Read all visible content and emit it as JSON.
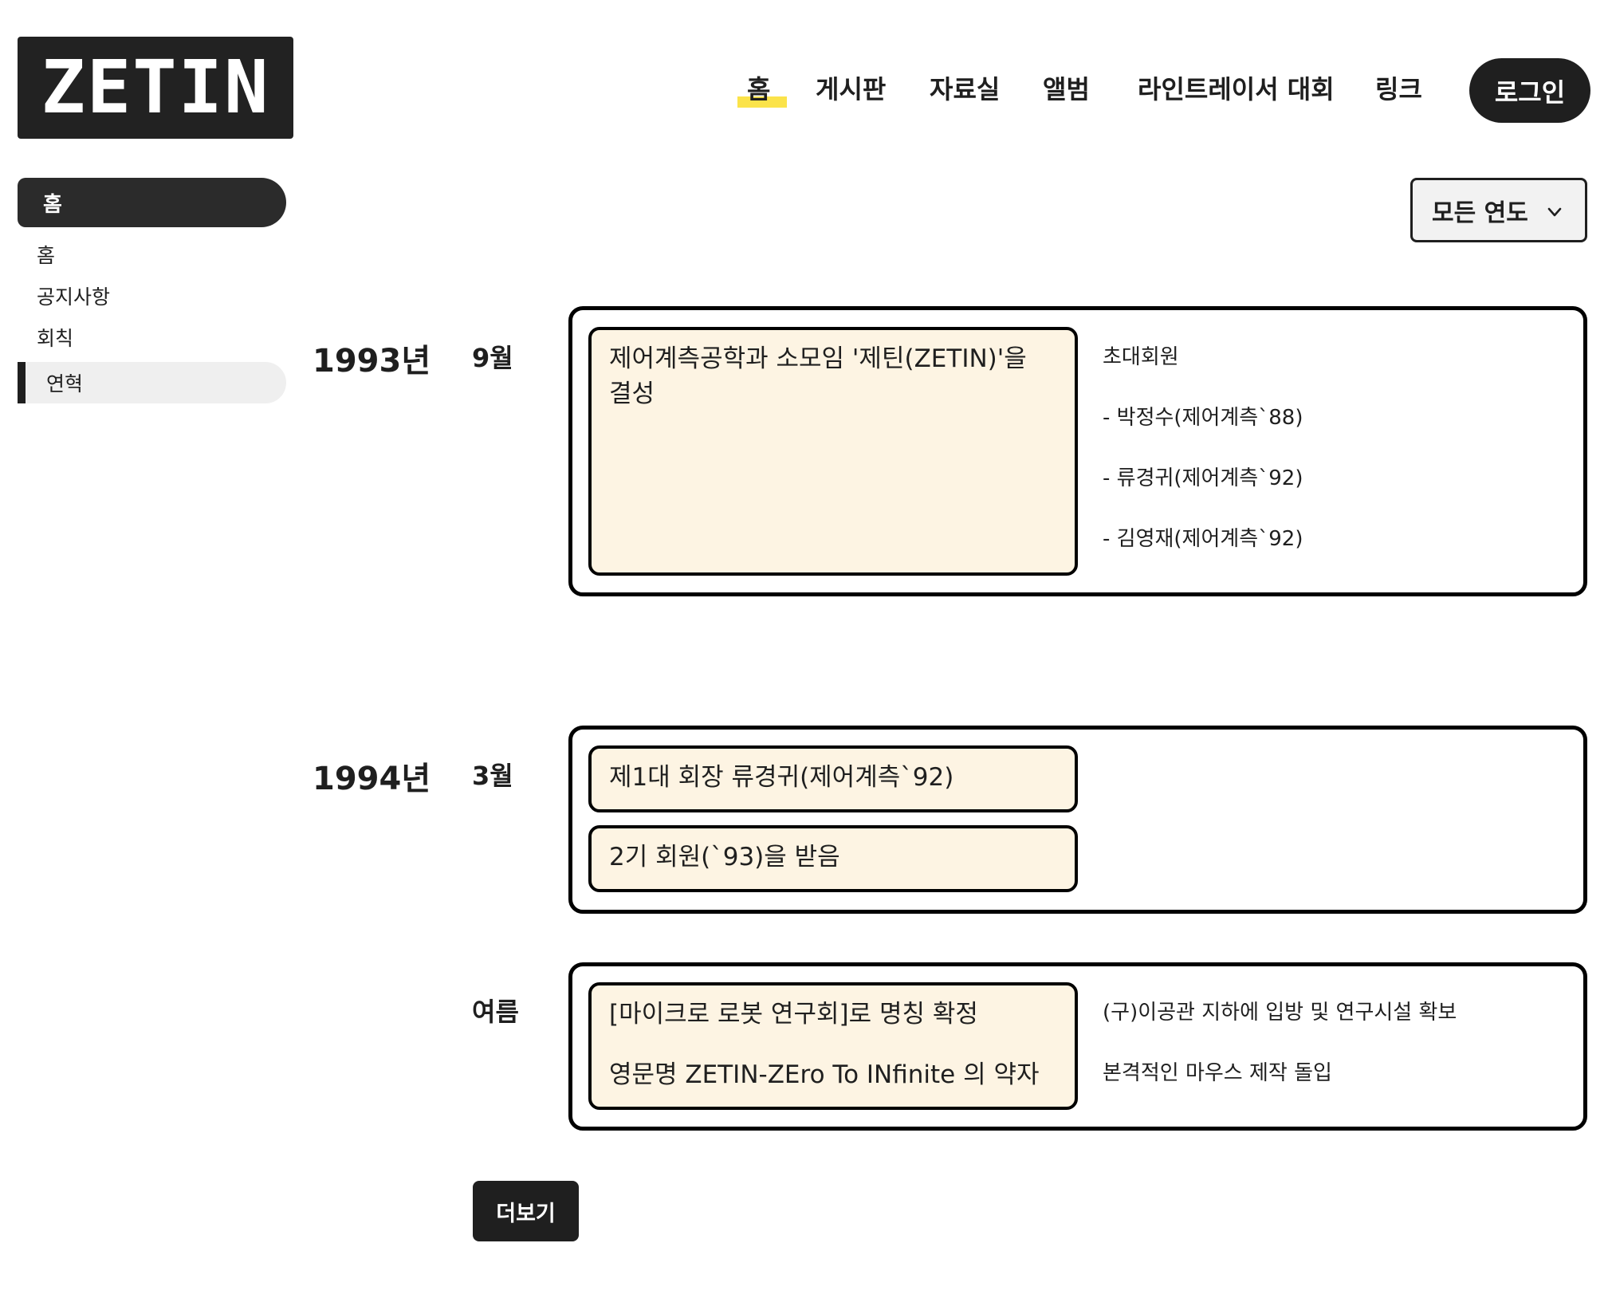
{
  "logo": "ZETIN",
  "nav": {
    "items": [
      "홈",
      "게시판",
      "자료실",
      "앨범",
      "라인트레이서 대회",
      "링크"
    ],
    "active": "홈",
    "login": "로그인"
  },
  "sidebar": {
    "title": "홈",
    "items": [
      "홈",
      "공지사항",
      "회칙"
    ],
    "active_item": "연혁"
  },
  "filter": {
    "selected": "모든 연도"
  },
  "timeline": {
    "y1993": {
      "year": "1993년",
      "month": "9월",
      "event": "제어계측공학과 소모임 '제틴(ZETIN)'을 결성",
      "notes": [
        "초대회원",
        "- 박정수(제어계측`88)",
        "- 류경귀(제어계측`92)",
        "- 김영재(제어계측`92)"
      ]
    },
    "y1994": {
      "year": "1994년",
      "march": {
        "month": "3월",
        "events": [
          "제1대 회장 류경귀(제어계측`92)",
          "2기 회원(`93)을 받음"
        ]
      },
      "summer": {
        "month": "여름",
        "events": [
          "[마이크로 로봇 연구회]로 명칭 확정",
          "영문명 ZETIN-ZEro To INfinite 의 약자"
        ],
        "notes": [
          "(구)이공관 지하에 입방 및 연구시설 확보",
          "본격적인 마우스 제작 돌입"
        ]
      }
    }
  },
  "more_button": "더보기",
  "colors": {
    "accent_underline": "#fbe34a",
    "event_bg": "#fdf4e3",
    "dark": "#1f1f1f"
  },
  "icons": {
    "dropdown": "chevron-down-icon"
  }
}
